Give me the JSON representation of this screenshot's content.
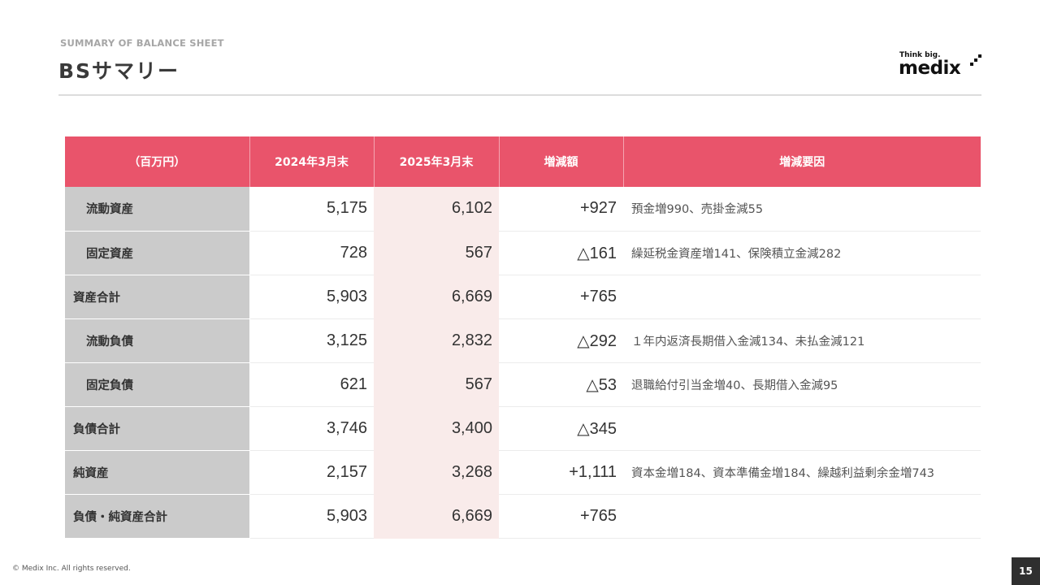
{
  "header": {
    "subtitle": "SUMMARY OF BALANCE SHEET",
    "title": "BSサマリー"
  },
  "logo": {
    "tagline": "Think big.",
    "word": "medix"
  },
  "table": {
    "headers": [
      "（百万円）",
      "2024年3月末",
      "2025年3月末",
      "増減額",
      "増減要因"
    ],
    "rows": [
      {
        "label": "流動資産",
        "indent": 1,
        "prev": "5,175",
        "curr": "6,102",
        "diff": "+927",
        "reason": "預金増990、売掛金減55"
      },
      {
        "label": "固定資産",
        "indent": 1,
        "prev": "728",
        "curr": "567",
        "diff": "△161",
        "reason": "繰延税金資産増141、保険積立金減282"
      },
      {
        "label": "資産合計",
        "indent": 0,
        "prev": "5,903",
        "curr": "6,669",
        "diff": "+765",
        "reason": ""
      },
      {
        "label": "流動負債",
        "indent": 1,
        "prev": "3,125",
        "curr": "2,832",
        "diff": "△292",
        "reason": "１年内返済長期借入金減134、未払金減121"
      },
      {
        "label": "固定負債",
        "indent": 1,
        "prev": "621",
        "curr": "567",
        "diff": "△53",
        "reason": "退職給付引当金増40、長期借入金減95"
      },
      {
        "label": "負債合計",
        "indent": 0,
        "prev": "3,746",
        "curr": "3,400",
        "diff": "△345",
        "reason": ""
      },
      {
        "label": "純資産",
        "indent": 0,
        "prev": "2,157",
        "curr": "3,268",
        "diff": "+1,111",
        "reason": "資本金増184、資本準備金増184、繰越利益剰余金増743"
      },
      {
        "label": "負債・純資産合計",
        "indent": 0,
        "prev": "5,903",
        "curr": "6,669",
        "diff": "+765",
        "reason": ""
      }
    ]
  },
  "footer": {
    "copyright": "© Medix Inc. All rights reserved.",
    "page": "15"
  },
  "colors": {
    "header_fill": "#e9546b",
    "label_fill": "#cbcbcb",
    "highlight_column": "#f9ebea",
    "page_badge": "#2f2f2f"
  }
}
